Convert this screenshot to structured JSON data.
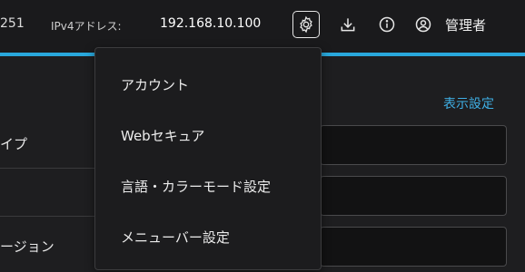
{
  "header": {
    "ip_prefix": "251",
    "ip_label": "IPv4アドレス:",
    "ip_value": "192.168.10.100",
    "admin_label": "管理者"
  },
  "icons": {
    "settings": "gear-icon",
    "download": "download-icon",
    "info": "info-icon",
    "user": "user-icon"
  },
  "main": {
    "display_settings_link": "表示設定",
    "rows": [
      {
        "label": "イプ"
      },
      {
        "label": ""
      },
      {
        "label": "ージョン"
      }
    ]
  },
  "menu": {
    "items": [
      {
        "label": "アカウント"
      },
      {
        "label": "Webセキュア"
      },
      {
        "label": "言語・カラーモード設定"
      },
      {
        "label": "メニューバー設定"
      }
    ]
  },
  "colors": {
    "accent": "#29a8dc",
    "link": "#3fb0e6",
    "background": "#1e1e20"
  }
}
